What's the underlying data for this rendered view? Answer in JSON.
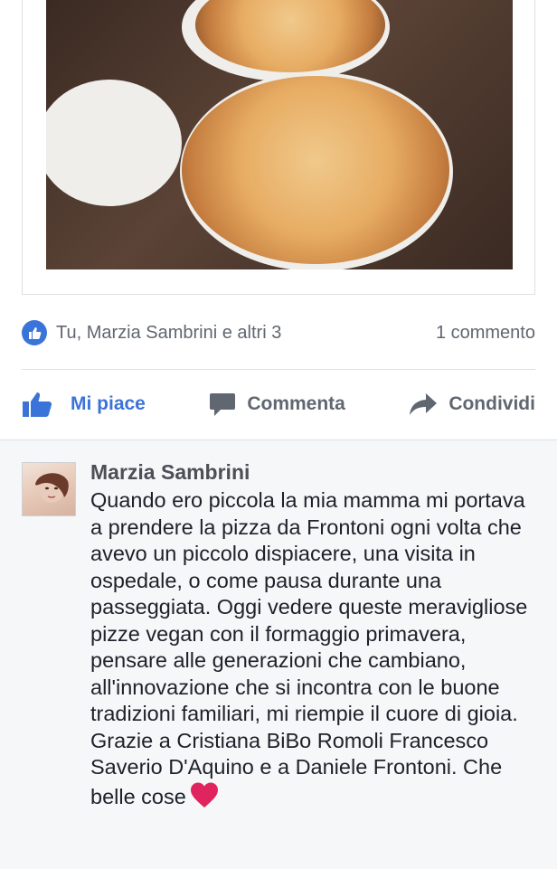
{
  "post": {
    "photo_alt": "pizza-photo"
  },
  "reactions": {
    "likers_text": "Tu, Marzia Sambrini e altri 3",
    "comments_count": "1 commento"
  },
  "actions": {
    "like": "Mi piace",
    "comment": "Commenta",
    "share": "Condividi"
  },
  "comment": {
    "author": "Marzia Sambrini",
    "text": "Quando ero piccola la mia mamma mi portava a prendere la pizza da Frontoni ogni volta che avevo un piccolo dispiacere, una visita in ospedale, o come pausa durante una passeggiata. Oggi vedere queste meravigliose  pizze vegan con il formaggio primavera, pensare alle generazioni che cambiano, all'innovazione che si incontra con le buone tradizioni familiari, mi riempie il cuore di gioia. Grazie a Cristiana BiBo Romoli Francesco Saverio D'Aquino e a Daniele Frontoni. Che belle cose"
  },
  "colors": {
    "accent": "#3b74d8",
    "muted": "#606770",
    "heart": "#e0245e"
  }
}
